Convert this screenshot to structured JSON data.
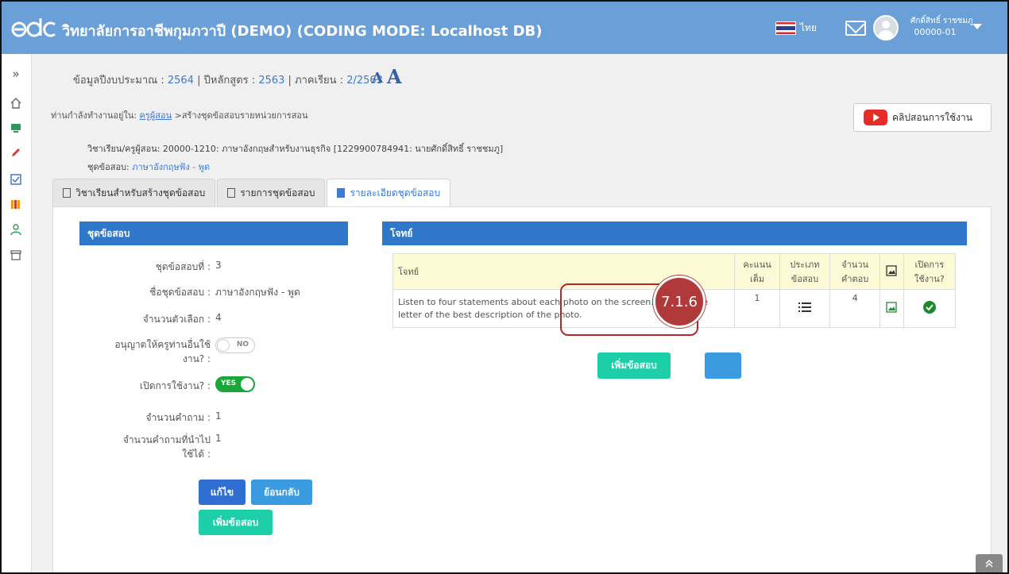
{
  "header": {
    "logo": "edc",
    "title": "วิทยาลัยการอาชีพกุมภวาปี (DEMO) (CODING MODE: Localhost DB)",
    "language": "ไทย",
    "user_name": "ศักดิ์สิทธิ์ ราชชมภู",
    "user_code": "00000-01"
  },
  "sidebar": {
    "icons": [
      "chevron-double-right-icon",
      "home-icon",
      "monitor-icon",
      "pencil-icon",
      "checkbox-icon",
      "books-icon",
      "user-icon",
      "archive-icon"
    ]
  },
  "info": {
    "budget_label": "ข้อมูลปีงบประมาณ :",
    "budget_value": "2564",
    "curriculum_label": "ปีหลักสูตร :",
    "curriculum_value": "2563",
    "term_label": "ภาคเรียน :",
    "term_value": "2/2563",
    "font_small": "A",
    "font_large": "A"
  },
  "breadcrumb": {
    "prefix": "ท่านกำลังทำงานอยู่ใน:",
    "link": "ครูผู้สอน",
    "current": ">สร้างชุดข้อสอบรายหน่วยการสอน"
  },
  "video_button": "คลิปสอนการใช้งาน",
  "subject_line": "วิชาเรียน/ครูผู้สอน: 20000-1210: ภาษาอังกฤษสำหรับงานธุรกิจ [1229900784941: นายศักดิ์สิทธิ์ ราชชมภู]",
  "set_label": "ชุดข้อสอบ:",
  "set_name": "ภาษาอังกฤษฟัง - พูด",
  "tabs": [
    {
      "label": "วิชาเรียนสำหรับสร้างชุดข้อสอบ"
    },
    {
      "label": "รายการชุดข้อสอบ"
    },
    {
      "label": "รายละเอียดชุดข้อสอบ"
    }
  ],
  "left_panel": {
    "title": "ชุดข้อสอบ",
    "fields": [
      {
        "label": "ชุดข้อสอบที่ :",
        "value": "3"
      },
      {
        "label": "ชื่อชุดข้อสอบ :",
        "value": "ภาษาอังกฤษฟัง - พูด"
      },
      {
        "label": "จำนวนตัวเลือก :",
        "value": "4"
      },
      {
        "label": "อนุญาตให้ครูท่านอื่นใช้งาน? :",
        "label_line1": "อนุญาตให้ครูท่านอื่นใช้",
        "label_line2": "งาน? :",
        "value": "NO"
      },
      {
        "label": "เปิดการใช้งาน? :",
        "value": "YES"
      },
      {
        "label": "จำนวนคำถาม :",
        "value": "1"
      },
      {
        "label": "จำนวนคำถามที่นำไปใช้ได้ :",
        "label_line1": "จำนวนคำถามที่นำไป",
        "label_line2": "ใช้ได้ :",
        "value": "1"
      }
    ],
    "edit_button": "แก้ไข",
    "back_button": "ย้อนกลับ",
    "add_button": "เพิ่มข้อสอบ"
  },
  "right_panel": {
    "title": "โจทย์",
    "columns": [
      "โจทย์",
      "คะแนนเต็ม",
      "ประเภทข้อสอบ",
      "จำนวนคำตอบ",
      "image-icon",
      "เปิดการใช้งาน?"
    ],
    "col_score_1": "คะแนน",
    "col_score_2": "เต็ม",
    "col_type_1": "ประเภท",
    "col_type_2": "ข้อสอบ",
    "col_ans_1": "จำนวน",
    "col_ans_2": "คำตอบ",
    "col_active_1": "เปิดการ",
    "col_active_2": "ใช้งาน?",
    "rows": [
      {
        "question": "Listen to four statements about each photo on the screen. Click on the letter of the best description of the photo.",
        "score": "1",
        "type_icon": "list-icon",
        "answers": "4",
        "image_icon": "image-icon",
        "active_icon": "check-circle-icon"
      }
    ],
    "add_button": "เพิ่มข้อสอบ"
  },
  "annotation": "7.1.6",
  "colors": {
    "topbar": "#6a9fd8",
    "panel_head": "#2f77c8",
    "edit_btn": "#2e6fd1",
    "back_btn": "#3a9be0",
    "add_btn": "#1dcfa8",
    "toggle_on": "#1aa73a",
    "annotation": "#b5252a"
  }
}
